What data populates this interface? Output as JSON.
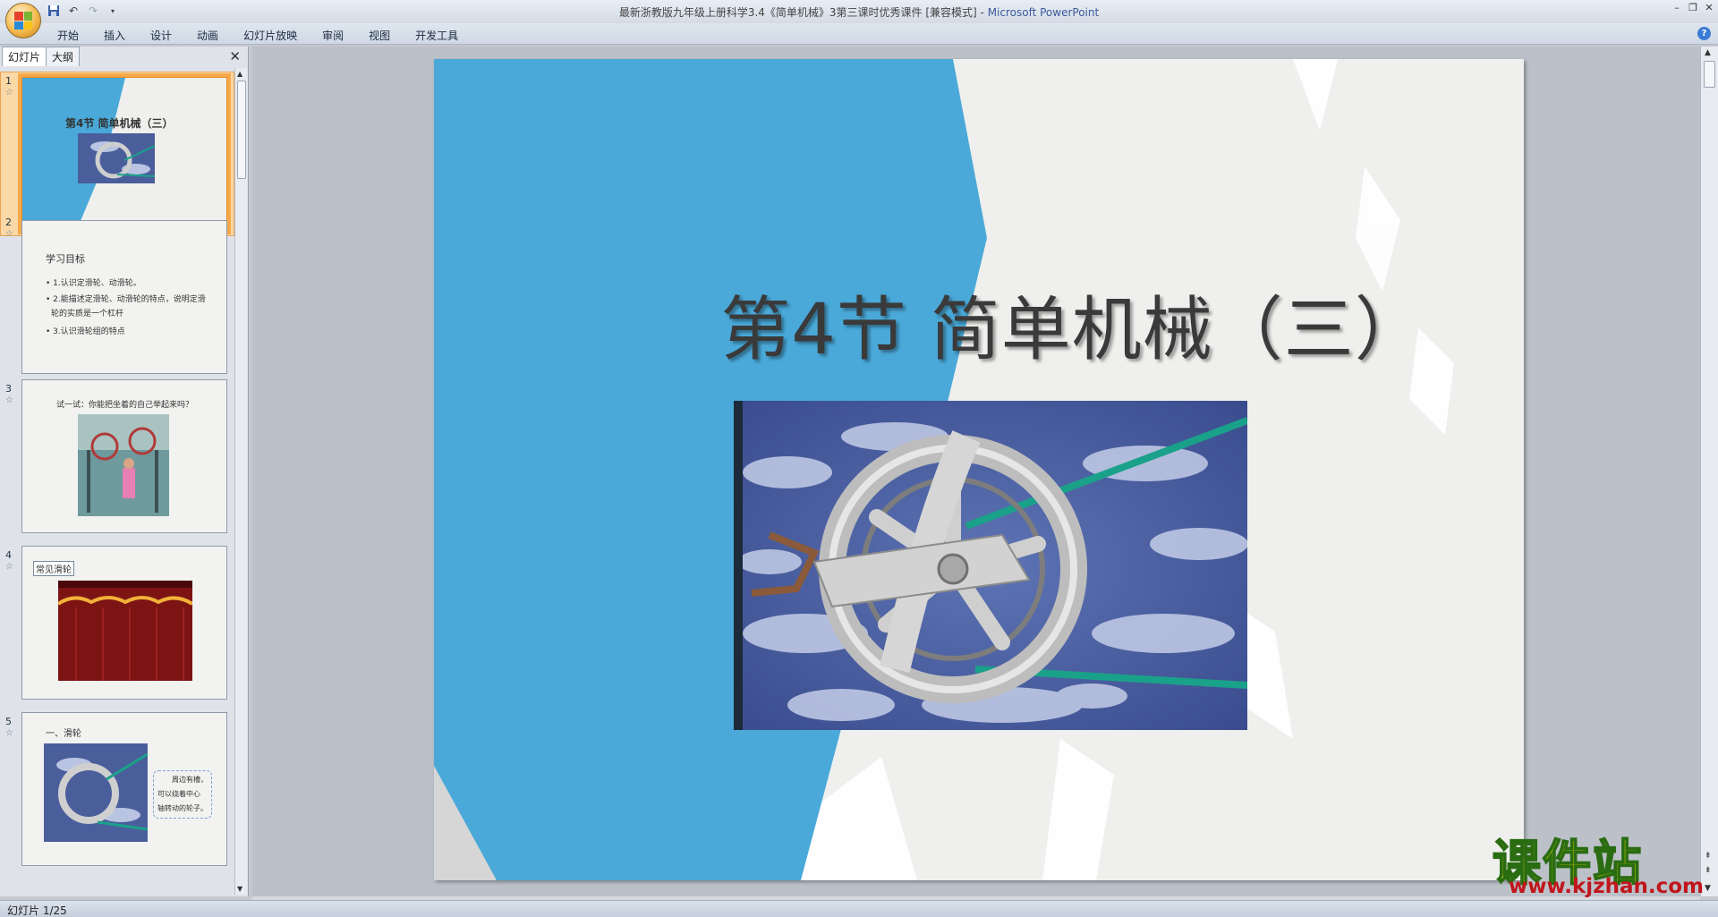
{
  "window": {
    "doc_title": "最新浙教版九年级上册科学3.4《简单机械》3第三课时优秀课件 [兼容模式]",
    "app_name": "Microsoft PowerPoint",
    "sep": " - "
  },
  "ribbon": {
    "tabs": [
      "开始",
      "插入",
      "设计",
      "动画",
      "幻灯片放映",
      "审阅",
      "视图",
      "开发工具"
    ],
    "help": "?"
  },
  "left_pane": {
    "tabs": [
      "幻灯片",
      "大纲"
    ],
    "close": "✕",
    "slides": [
      {
        "num": "1",
        "title": "第4节 简单机械（三）"
      },
      {
        "num": "2",
        "heading": "学习目标",
        "bullets": [
          "• 1.认识定滑轮、动滑轮。",
          "• 2.能描述定滑轮、动滑轮的特点，说明定滑",
          "轮的实质是一个杠杆",
          "• 3.认识滑轮组的特点"
        ]
      },
      {
        "num": "3",
        "caption": "试一试：你能把坐着的自己举起来吗？"
      },
      {
        "num": "4",
        "label": "常见滑轮"
      },
      {
        "num": "5",
        "heading": "一、滑轮",
        "note": [
          "周边有槽，",
          "可以绕着中心",
          "轴转动的轮子。"
        ]
      }
    ]
  },
  "slide": {
    "title": "第4节 简单机械（三）"
  },
  "status": {
    "slide_counter": "幻灯片 1/25"
  },
  "watermark": {
    "text": "课件站",
    "url": "www.kjzhan.com"
  },
  "colors": {
    "slide_blue": "#4aa9d9",
    "selection": "#f7a94a",
    "watermark_yellow": "#f2e400",
    "watermark_red": "#c0161c"
  }
}
